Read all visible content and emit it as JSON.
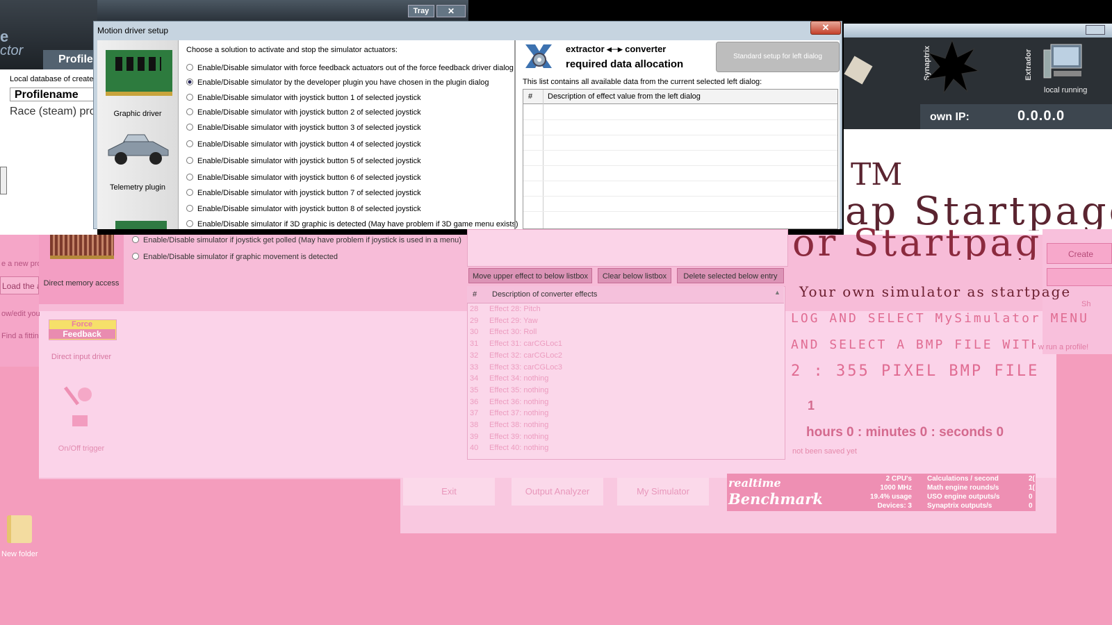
{
  "back_app": {
    "logo_partial_1": "e",
    "logo_partial_2": "ctor",
    "profile_tab": "Profile",
    "local_db_text": "Local database of created",
    "column_header": "Profilename",
    "row_1": "Race (steam) pro",
    "tray_button": "Tray",
    "close_button": "✕",
    "links": [
      "e a new profi",
      "Load the a",
      "ow/edit you",
      "Find a fittin"
    ]
  },
  "right_app": {
    "synaptrix_label": "Synaptrix",
    "extractor_label": "Extrador",
    "local_running": "local running",
    "own_ip_label": "own IP:",
    "own_ip_value": "0.0.0.0",
    "create_button": "Create",
    "sh_text": "Sh",
    "run_profile_text": "w run a profile!"
  },
  "startpage": {
    "title_fragment_top": "TM",
    "title_fragment_mid": "ap Startpage",
    "title_fragment_pink": "or Startpage",
    "subtitle": "Your own simulator as startpage",
    "line1": "LOG AND SELECT  MySimulator MENU",
    "line2": "AND SELECT A BMP FILE WITH A PICTUR",
    "line3": "2 : 355 PIXEL BMP FILE",
    "number": "1",
    "timer": "hours  0 : minutes  0 : seconds  0",
    "not_saved": "not been saved yet"
  },
  "dialog": {
    "title": "Motion driver setup",
    "close": "✕",
    "left_items": [
      {
        "label": "Graphic driver",
        "icon": "graphics-card-icon"
      },
      {
        "label": "Telemetry plugin",
        "icon": "race-car-icon"
      },
      {
        "label": "Direct memory access",
        "icon": "memory-chip-icon"
      },
      {
        "label": "Direct input driver",
        "icon": "force-feedback-icon",
        "badge_1": "Force",
        "badge_2": "Feedback"
      },
      {
        "label": "On/Off trigger",
        "icon": "trigger-icon"
      }
    ],
    "choose_text": "Choose a solution to activate and stop the simulator actuators:",
    "options": [
      {
        "label": "Enable/Disable simulator with force feedback actuators out of the force feedback driver dialog",
        "selected": false
      },
      {
        "label": "Enable/Disable simulator by the developer plugin you have chosen in the plugin dialog",
        "selected": true
      },
      {
        "label": "Enable/Disable simulator with joystick button 1 of selected joystick",
        "selected": false
      },
      {
        "label": "Enable/Disable simulator with joystick button 2 of selected joystick",
        "selected": false
      },
      {
        "label": "Enable/Disable simulator with joystick button 3 of selected joystick",
        "selected": false
      },
      {
        "label": "Enable/Disable simulator with joystick button 4 of selected joystick",
        "selected": false
      },
      {
        "label": "Enable/Disable simulator with joystick button 5 of selected joystick",
        "selected": false
      },
      {
        "label": "Enable/Disable simulator with joystick button 6 of selected joystick",
        "selected": false
      },
      {
        "label": "Enable/Disable simulator with joystick button 7 of selected joystick",
        "selected": false
      },
      {
        "label": "Enable/Disable simulator with joystick button 8 of selected joystick",
        "selected": false
      },
      {
        "label": "Enable/Disable simulator if 3D graphic is detected (May have problem if 3D game menu exists)",
        "selected": false
      },
      {
        "label": "Enable/Disable simulator if joystick get polled (May have problem if joystick is used in a menu)",
        "selected": false
      },
      {
        "label": "Enable/Disable simulator if graphic movement is detected",
        "selected": false
      }
    ],
    "extractor_title_1": "extractor ◂─▸ converter",
    "extractor_title_2": "required data allocation",
    "standard_setup_button": "Standard setup for left dialog",
    "list_info": "This list contains all available data from the current selected left dialog:",
    "table_hash": "#",
    "table_desc_header": "Description of effect value from the left dialog",
    "move_button": "Move upper effect to below listbox",
    "clear_button": "Clear below listbox",
    "delete_button": "Delete selected below entry",
    "converter_hash": "#",
    "converter_header": "Description of converter effects",
    "converter_effects": [
      {
        "n": "28",
        "label": "Effect 28: Pitch"
      },
      {
        "n": "29",
        "label": "Effect 29: Yaw"
      },
      {
        "n": "30",
        "label": "Effect 30: Roll"
      },
      {
        "n": "31",
        "label": "Effect 31: carCGLoc1"
      },
      {
        "n": "32",
        "label": "Effect 32: carCGLoc2"
      },
      {
        "n": "33",
        "label": "Effect 33: carCGLoc3"
      },
      {
        "n": "34",
        "label": "Effect 34: nothing"
      },
      {
        "n": "35",
        "label": "Effect 35: nothing"
      },
      {
        "n": "36",
        "label": "Effect 36: nothing"
      },
      {
        "n": "37",
        "label": "Effect 37: nothing"
      },
      {
        "n": "38",
        "label": "Effect 38: nothing"
      },
      {
        "n": "39",
        "label": "Effect 39: nothing"
      },
      {
        "n": "40",
        "label": "Effect 40: nothing"
      }
    ]
  },
  "bottom_bar": {
    "exit": "Exit",
    "output_analyzer": "Output Analyzer",
    "my_simulator": "My Simulator"
  },
  "benchmark": {
    "logo_1": "realtime",
    "logo_2": "Benchmark",
    "stats_left": [
      "2 CPU's",
      "1000 MHz",
      "19.4% usage",
      "Devices: 3"
    ],
    "stats_mid": [
      "Calculations / second",
      "Math engine rounds/s",
      "USO engine outputs/s",
      "Synaptrix outputs/s"
    ],
    "stats_right": [
      "2(",
      "1(",
      "0",
      "0"
    ]
  },
  "desktop": {
    "folder_label": "New folder"
  }
}
